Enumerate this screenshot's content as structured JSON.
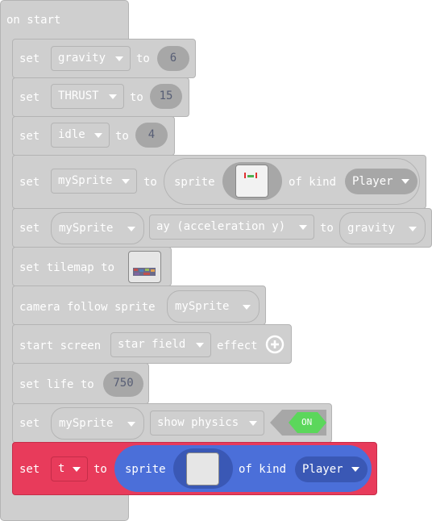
{
  "hat": {
    "label": "on start"
  },
  "colors": {
    "block_grey": "#cfcfcf",
    "field_grey": "#a7a7a7",
    "selected_red": "#e83b5b",
    "sprite_blue": "#4b6fd9",
    "toggle_green": "#5bd75b"
  },
  "blocks": {
    "gravity": {
      "set": "set",
      "var": "gravity",
      "to": "to",
      "value": "6"
    },
    "thrust": {
      "set": "set",
      "var": "THRUST",
      "to": "to",
      "value": "15"
    },
    "idle": {
      "set": "set",
      "var": "idle",
      "to": "to",
      "value": "4"
    },
    "mysprite": {
      "set": "set",
      "var": "mySprite",
      "to": "to",
      "sprite": "sprite",
      "of_kind": "of kind",
      "kind": "Player"
    },
    "accel": {
      "set": "set",
      "var": "mySprite",
      "property": "ay (acceleration y)",
      "to": "to",
      "value": "gravity"
    },
    "tilemap": {
      "label": "set tilemap to"
    },
    "camera": {
      "label": "camera follow sprite",
      "var": "mySprite"
    },
    "effect": {
      "start": "start screen",
      "effect_name": "star field",
      "effect": "effect"
    },
    "life": {
      "label": "set life to",
      "value": "750"
    },
    "physics": {
      "set": "set",
      "var": "mySprite",
      "flag": "show physics",
      "toggle": "ON"
    },
    "t_block": {
      "set": "set",
      "var": "t",
      "to": "to",
      "sprite": "sprite",
      "of_kind": "of kind",
      "kind": "Player"
    }
  }
}
